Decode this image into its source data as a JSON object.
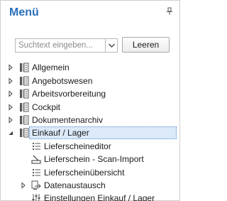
{
  "panel": {
    "title": "Menü",
    "pin_icon": "pin-icon"
  },
  "search": {
    "placeholder": "Suchtext eingeben...",
    "value": "",
    "clear_label": "Leeren"
  },
  "tree": {
    "items": [
      {
        "label": "Allgemein",
        "icon": "document-folder-icon",
        "expanded": false
      },
      {
        "label": "Angebotswesen",
        "icon": "document-folder-icon",
        "expanded": false
      },
      {
        "label": "Arbeitsvorbereitung",
        "icon": "document-folder-icon",
        "expanded": false
      },
      {
        "label": "Cockpit",
        "icon": "document-folder-icon",
        "expanded": false
      },
      {
        "label": "Dokumentenarchiv",
        "icon": "document-folder-icon",
        "expanded": false
      },
      {
        "label": "Einkauf / Lager",
        "icon": "document-folder-icon",
        "expanded": true,
        "selected": true,
        "children": [
          {
            "label": "Lieferscheineditor",
            "icon": "list-icon"
          },
          {
            "label": "Lieferschein - Scan-Import",
            "icon": "scan-icon"
          },
          {
            "label": "Lieferscheinübersicht",
            "icon": "list-icon"
          },
          {
            "label": "Datenaustausch",
            "icon": "data-exchange-icon",
            "expandable": true
          },
          {
            "label": "Einstellungen Einkauf / Lager",
            "icon": "settings-sliders-icon"
          }
        ]
      }
    ]
  },
  "colors": {
    "title": "#2a6fba",
    "selection_bg": "#dbe9f8",
    "selection_border": "#5b8fd0"
  }
}
